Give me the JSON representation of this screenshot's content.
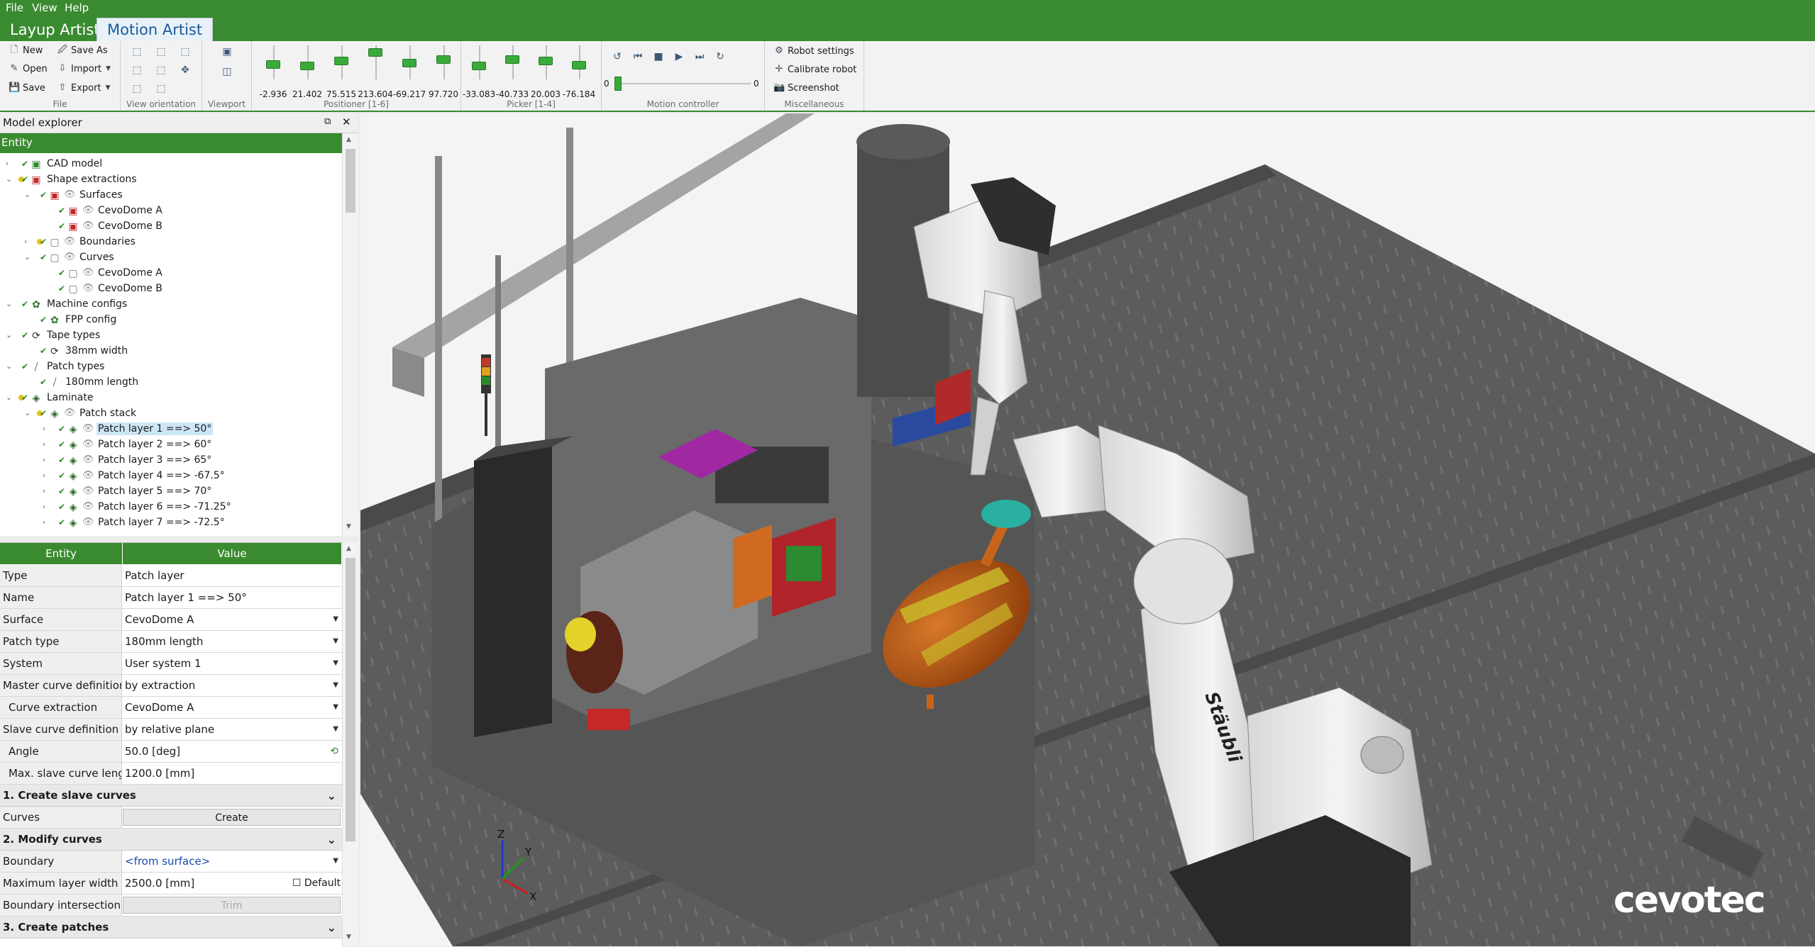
{
  "menu": [
    "File",
    "View",
    "Help"
  ],
  "app_tabs": [
    {
      "label": "Layup Artist",
      "active": false
    },
    {
      "label": "Motion Artist",
      "active": true
    }
  ],
  "ribbon": {
    "file": {
      "label": "File",
      "new": "New",
      "save_as": "Save As",
      "open": "Open",
      "import": "Import",
      "save": "Save",
      "export": "Export"
    },
    "view_orientation": {
      "label": "View orientation"
    },
    "viewport": {
      "label": "Viewport"
    },
    "positioner": {
      "label": "Positioner [1-6]",
      "values": [
        "-2.936",
        "21.402",
        "75.515",
        "213.604",
        "-69.217",
        "97.720"
      ],
      "levels": [
        0.42,
        0.35,
        0.55,
        0.88,
        0.48,
        0.62
      ]
    },
    "picker": {
      "label": "Picker [1-4]",
      "values": [
        "-33.083",
        "-40.733",
        "20.003",
        "-76.184"
      ],
      "levels": [
        0.35,
        0.62,
        0.55,
        0.4
      ]
    },
    "motion_controller": {
      "label": "Motion controller",
      "min": "0",
      "max": "0"
    },
    "misc": {
      "label": "Miscellaneous",
      "robot_settings": "Robot settings",
      "calibrate_robot": "Calibrate robot",
      "screenshot": "Screenshot"
    }
  },
  "explorer": {
    "title": "Model explorer",
    "column": "Entity",
    "tree": [
      {
        "label": "CAD model",
        "depth": 0,
        "arrow": "right",
        "dot": "",
        "icon": "cube-green",
        "eye": false
      },
      {
        "label": "Shape extractions",
        "depth": 0,
        "arrow": "down",
        "dot": "yellow",
        "icon": "cube-red",
        "eye": false
      },
      {
        "label": "Surfaces",
        "depth": 1,
        "arrow": "down",
        "dot": "",
        "icon": "cube-red",
        "eye": true
      },
      {
        "label": "CevoDome A",
        "depth": 2,
        "arrow": "",
        "dot": "",
        "icon": "cube-red",
        "eye": true
      },
      {
        "label": "CevoDome B",
        "depth": 2,
        "arrow": "",
        "dot": "",
        "icon": "cube-red",
        "eye": true
      },
      {
        "label": "Boundaries",
        "depth": 1,
        "arrow": "right",
        "dot": "yellow",
        "icon": "cube-outline",
        "eye": true
      },
      {
        "label": "Curves",
        "depth": 1,
        "arrow": "down",
        "dot": "",
        "icon": "cube-outline",
        "eye": true
      },
      {
        "label": "CevoDome A",
        "depth": 2,
        "arrow": "",
        "dot": "",
        "icon": "cube-outline",
        "eye": true
      },
      {
        "label": "CevoDome B",
        "depth": 2,
        "arrow": "",
        "dot": "",
        "icon": "cube-outline",
        "eye": true
      },
      {
        "label": "Machine configs",
        "depth": 0,
        "arrow": "down",
        "dot": "",
        "icon": "gear-green",
        "eye": false
      },
      {
        "label": "FPP config",
        "depth": 1,
        "arrow": "",
        "dot": "",
        "icon": "gear-green",
        "eye": false
      },
      {
        "label": "Tape types",
        "depth": 0,
        "arrow": "down",
        "dot": "",
        "icon": "tape",
        "eye": false
      },
      {
        "label": "38mm width",
        "depth": 1,
        "arrow": "",
        "dot": "",
        "icon": "tape",
        "eye": false
      },
      {
        "label": "Patch types",
        "depth": 0,
        "arrow": "down",
        "dot": "",
        "icon": "patch",
        "eye": false
      },
      {
        "label": "180mm length",
        "depth": 1,
        "arrow": "",
        "dot": "",
        "icon": "patch",
        "eye": false
      },
      {
        "label": "Laminate",
        "depth": 0,
        "arrow": "down",
        "dot": "yellow",
        "icon": "layers",
        "eye": false
      },
      {
        "label": "Patch stack",
        "depth": 1,
        "arrow": "down",
        "dot": "yellow",
        "icon": "layers",
        "eye": true
      },
      {
        "label": "Patch layer 1 ==> 50°",
        "depth": 2,
        "arrow": "right",
        "dot": "",
        "icon": "layers",
        "eye": true,
        "selected": true
      },
      {
        "label": "Patch layer 2 ==> 60°",
        "depth": 2,
        "arrow": "right",
        "dot": "",
        "icon": "layers",
        "eye": true
      },
      {
        "label": "Patch layer 3 ==> 65°",
        "depth": 2,
        "arrow": "right",
        "dot": "",
        "icon": "layers",
        "eye": true
      },
      {
        "label": "Patch layer 4 ==> -67.5°",
        "depth": 2,
        "arrow": "right",
        "dot": "",
        "icon": "layers",
        "eye": true
      },
      {
        "label": "Patch layer 5 ==> 70°",
        "depth": 2,
        "arrow": "right",
        "dot": "",
        "icon": "layers",
        "eye": true
      },
      {
        "label": "Patch layer 6 ==> -71.25°",
        "depth": 2,
        "arrow": "right",
        "dot": "",
        "icon": "layers",
        "eye": true
      },
      {
        "label": "Patch layer 7 ==> -72.5°",
        "depth": 2,
        "arrow": "right",
        "dot": "",
        "icon": "layers",
        "eye": true
      }
    ]
  },
  "properties": {
    "col_entity": "Entity",
    "col_value": "Value",
    "rows": [
      {
        "kind": "row",
        "key": "Type",
        "value": "Patch layer"
      },
      {
        "kind": "row",
        "key": "Name",
        "value": "Patch layer 1 ==> 50°"
      },
      {
        "kind": "row",
        "key": "Surface",
        "value": "CevoDome A",
        "dropdown": true
      },
      {
        "kind": "row",
        "key": "Patch type",
        "value": "180mm length",
        "dropdown": true
      },
      {
        "kind": "row",
        "key": "System",
        "value": "User system 1",
        "dropdown": true
      },
      {
        "kind": "row",
        "key": "Master curve definition",
        "value": "by extraction",
        "dropdown": true
      },
      {
        "kind": "row",
        "key": "Curve extraction",
        "value": "CevoDome A",
        "dropdown": true,
        "sub": true
      },
      {
        "kind": "row",
        "key": "Slave curve definition",
        "value": "by relative plane",
        "dropdown": true
      },
      {
        "kind": "row",
        "key": "Angle",
        "value": "50.0 [deg]",
        "sub": true,
        "reset": true
      },
      {
        "kind": "row",
        "key": "Max. slave curve length",
        "value": "1200.0 [mm]",
        "sub": true
      },
      {
        "kind": "section",
        "key": "1. Create slave curves"
      },
      {
        "kind": "button",
        "key": "Curves",
        "value": "Create"
      },
      {
        "kind": "section",
        "key": "2. Modify curves"
      },
      {
        "kind": "row",
        "key": "Boundary",
        "value": "<from surface>",
        "dropdown": true,
        "link": true
      },
      {
        "kind": "row",
        "key": "Maximum layer width",
        "value": "2500.0 [mm]",
        "checkbox": "Default"
      },
      {
        "kind": "button",
        "key": "Boundary intersection",
        "value": "Trim",
        "disabled": true
      },
      {
        "kind": "section",
        "key": "3. Create patches"
      }
    ]
  },
  "viewport": {
    "axes": {
      "x": "X",
      "y": "Y",
      "z": "Z"
    },
    "logo": "cevotec",
    "robot_brand": "Stäubli"
  },
  "colors": {
    "brand": "#3a8a30",
    "selection": "#cde6f7",
    "part": "#c8641a"
  }
}
